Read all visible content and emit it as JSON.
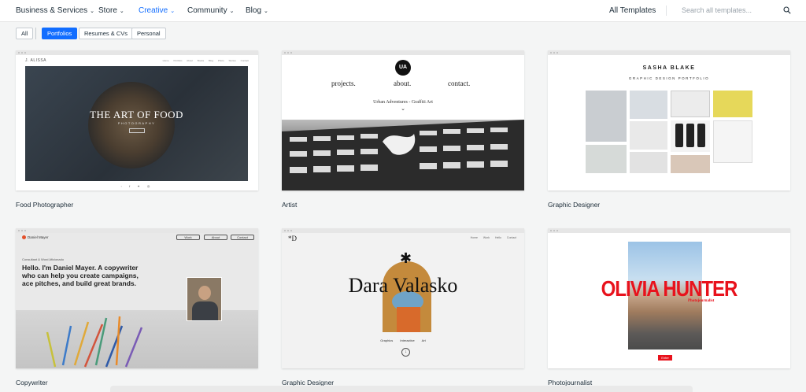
{
  "nav": {
    "items": [
      {
        "label": "Business & Services"
      },
      {
        "label": "Store"
      },
      {
        "label": "Creative"
      },
      {
        "label": "Community"
      },
      {
        "label": "Blog"
      }
    ],
    "all_templates": "All Templates",
    "search_placeholder": "Search all templates..."
  },
  "filters": {
    "all": "All",
    "items": [
      "Portfolios",
      "Resumes & CVs",
      "Personal"
    ],
    "selected": "Portfolios"
  },
  "accent_color": "#116dff",
  "cards": [
    {
      "title": "Food Photographer",
      "preview": {
        "logo": "J. ALISSA",
        "links": "Home Portfolio About Books Blog Photo Stories Contact",
        "hero_title": "THE ART OF FOOD",
        "hero_sub": "PHOTOGRAPHY",
        "social": "◦ f ✦ ◎"
      }
    },
    {
      "title": "Artist",
      "preview": {
        "logo": "UA",
        "nav": [
          "projects.",
          "about.",
          "contact."
        ],
        "tagline": "Urban Adventures - Graffiti Art"
      }
    },
    {
      "title": "Graphic Designer",
      "preview": {
        "name": "SASHA BLAKE",
        "subtitle": "GRAPHIC DESIGN PORTFOLIO"
      }
    },
    {
      "title": "Copywriter",
      "preview": {
        "logo": "Daniel Mayer",
        "buttons": [
          "Work",
          "About",
          "Contact"
        ],
        "small": "Consultant & Word Aficionado",
        "headline": "Hello. I'm Daniel Mayer. A copywriter who can help you create campaigns, ace pitches, and build great brands."
      }
    },
    {
      "title": "Graphic Designer",
      "preview": {
        "logo": "*D",
        "links": "Home Work Hello Contact",
        "name": "Dara Valasko",
        "tags": "Graphics Interactive Art"
      }
    },
    {
      "title": "Photojournalist",
      "preview": {
        "name": "OLIVIA HUNTER",
        "subtitle": "Photojournalist",
        "button": "Enter"
      }
    }
  ]
}
